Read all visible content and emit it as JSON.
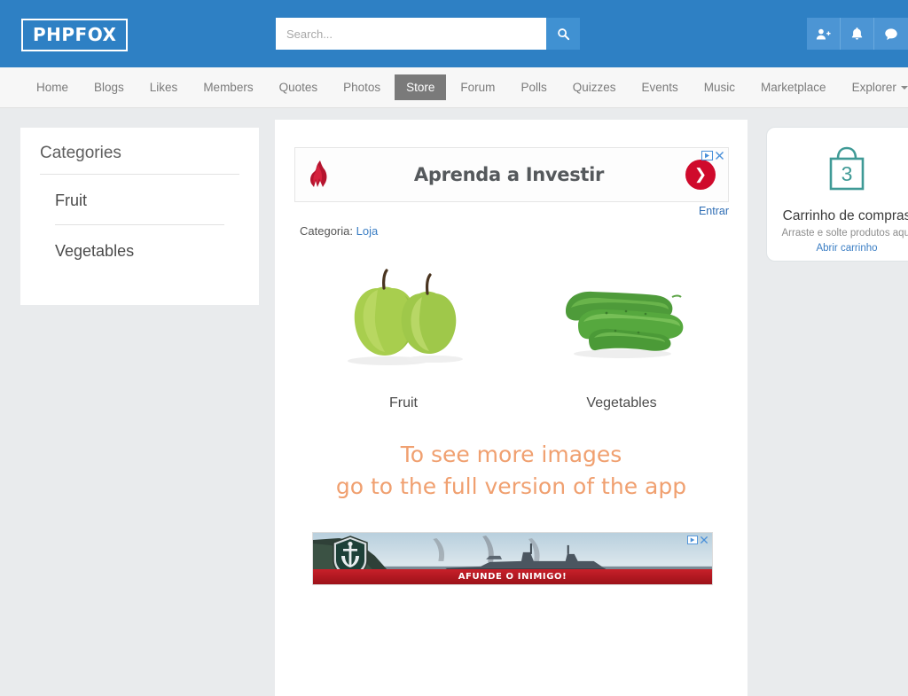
{
  "header": {
    "logo": "PHPFOX",
    "search": {
      "value": "",
      "placeholder": "Search..."
    },
    "search_button_icon": "search-icon",
    "icons": [
      {
        "name": "friend-request-icon",
        "label": "Friend requests"
      },
      {
        "name": "notification-bell-icon",
        "label": "Notifications"
      },
      {
        "name": "chat-bubble-icon",
        "label": "Messages"
      }
    ],
    "brand_color": "#2e80c4"
  },
  "nav": {
    "items": [
      {
        "label": "Home",
        "active": false
      },
      {
        "label": "Blogs",
        "active": false
      },
      {
        "label": "Likes",
        "active": false
      },
      {
        "label": "Members",
        "active": false
      },
      {
        "label": "Quotes",
        "active": false
      },
      {
        "label": "Photos",
        "active": false
      },
      {
        "label": "Store",
        "active": true
      },
      {
        "label": "Forum",
        "active": false
      },
      {
        "label": "Polls",
        "active": false
      },
      {
        "label": "Quizzes",
        "active": false
      },
      {
        "label": "Events",
        "active": false
      },
      {
        "label": "Music",
        "active": false
      },
      {
        "label": "Marketplace",
        "active": false
      },
      {
        "label": "Explorer",
        "active": false,
        "dropdown": true
      }
    ],
    "active_bg": "#7a7a7a"
  },
  "sidebar": {
    "title": "Categories",
    "items": [
      {
        "label": "Fruit"
      },
      {
        "label": "Vegetables"
      }
    ]
  },
  "main": {
    "ad_top": {
      "headline": "Aprenda a Investir",
      "cta_link": "Entrar",
      "arrow_icon": "chevron-right-icon",
      "logo_icon": "flame-logo-icon",
      "adchoices_icon": "adchoices-icon",
      "close_icon": "close-icon",
      "accent_color": "#cf0a2c"
    },
    "category_label": "Categoria:",
    "category_value": "Loja",
    "products": [
      {
        "label": "Fruit",
        "image": "green-apples-photo"
      },
      {
        "label": "Vegetables",
        "image": "cucumbers-photo"
      }
    ],
    "watermark_line1": "To see more images",
    "watermark_line2": "go to the full version of the app",
    "watermark_color": "#f0a070",
    "ad_bottom": {
      "slogan": "AFUNDE O INIMIGO!",
      "badge_icon": "warship-emblem-icon",
      "adchoices_icon": "adchoices-icon",
      "close_icon": "close-icon"
    }
  },
  "cart": {
    "icon": "shopping-bag-icon",
    "count": "3",
    "title": "Carrinho de compras",
    "subtitle": "Arraste e solte produtos aqui",
    "link": "Abrir carrinho",
    "accent_color": "#3f9a96"
  }
}
